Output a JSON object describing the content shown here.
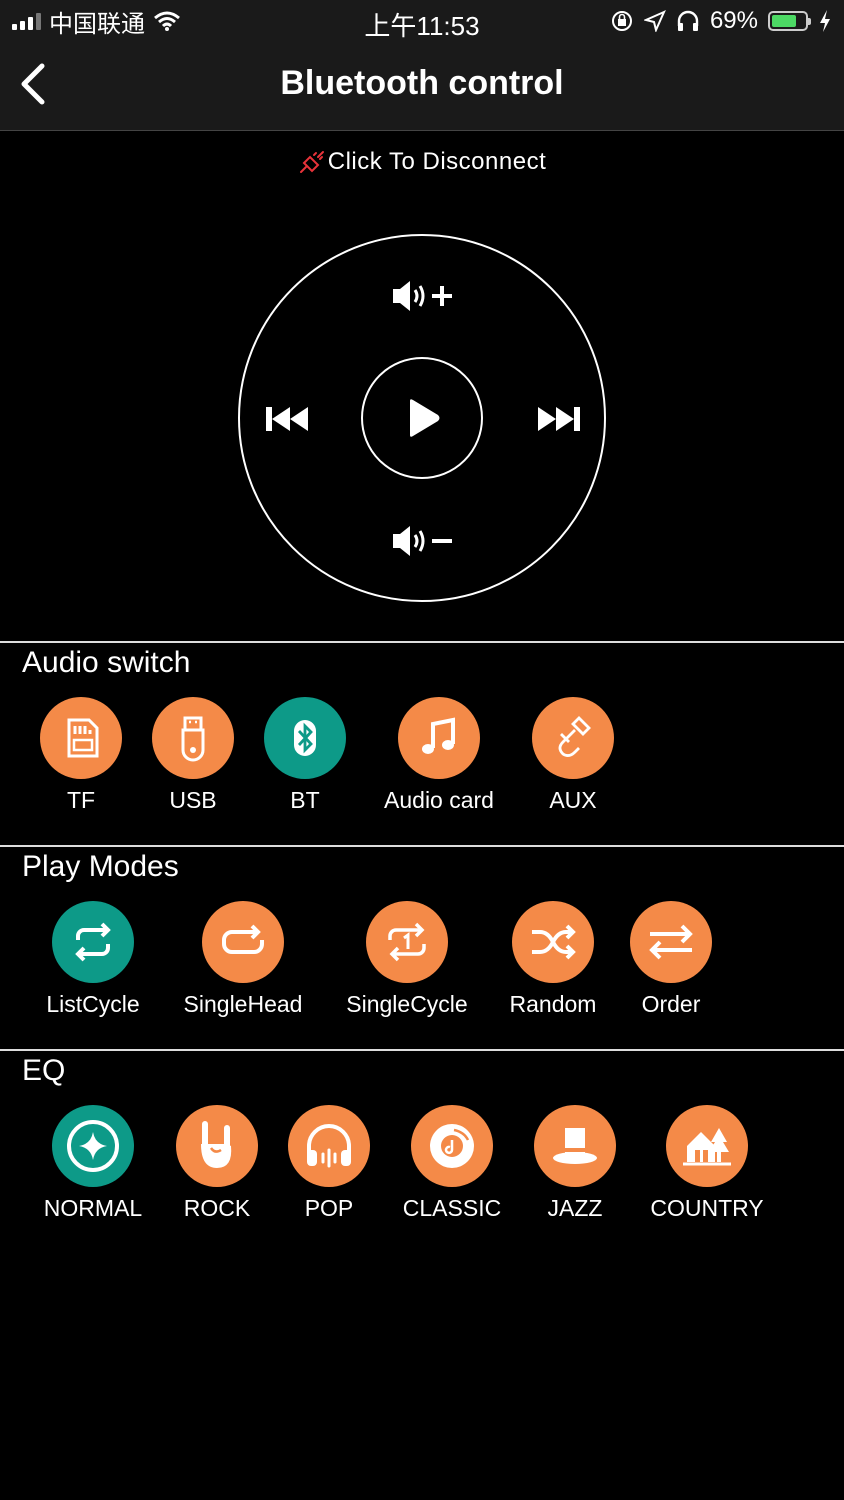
{
  "status_bar": {
    "carrier": "中国联通",
    "time": "上午11:53",
    "battery_percent": "69%",
    "battery_level": 0.69,
    "icons": [
      "signal-icon",
      "wifi-icon",
      "orientation-lock-icon",
      "location-icon",
      "headphones-icon",
      "battery-icon",
      "charging-icon"
    ]
  },
  "nav": {
    "title": "Bluetooth control",
    "back_icon": "chevron-left-icon"
  },
  "connection": {
    "label": "Click To Disconnect",
    "icon": "plug-icon",
    "icon_color": "#e8333a"
  },
  "controls": {
    "buttons": [
      "volume-up",
      "previous",
      "play",
      "next",
      "volume-down"
    ]
  },
  "audio_switch": {
    "title": "Audio switch",
    "items": [
      {
        "label": "TF",
        "icon": "sd-card-icon",
        "active": false
      },
      {
        "label": "USB",
        "icon": "usb-drive-icon",
        "active": false
      },
      {
        "label": "BT",
        "icon": "bluetooth-icon",
        "active": true
      },
      {
        "label": "Audio card",
        "icon": "music-note-icon",
        "active": false
      },
      {
        "label": "AUX",
        "icon": "aux-cable-icon",
        "active": false
      }
    ]
  },
  "play_modes": {
    "title": "Play Modes",
    "items": [
      {
        "label": "ListCycle",
        "icon": "repeat-all-icon",
        "active": true
      },
      {
        "label": "SingleHead",
        "icon": "repeat-once-loop-icon",
        "active": false
      },
      {
        "label": "SingleCycle",
        "icon": "repeat-one-icon",
        "active": false
      },
      {
        "label": "Random",
        "icon": "shuffle-icon",
        "active": false
      },
      {
        "label": "Order",
        "icon": "order-arrows-icon",
        "active": false
      }
    ]
  },
  "eq": {
    "title": "EQ",
    "items": [
      {
        "label": "NORMAL",
        "icon": "star-compass-icon",
        "active": true
      },
      {
        "label": "ROCK",
        "icon": "rock-hand-icon",
        "active": false
      },
      {
        "label": "POP",
        "icon": "headphones-icon",
        "active": false
      },
      {
        "label": "CLASSIC",
        "icon": "vinyl-record-icon",
        "active": false
      },
      {
        "label": "JAZZ",
        "icon": "hat-icon",
        "active": false
      },
      {
        "label": "COUNTRY",
        "icon": "house-tree-icon",
        "active": false
      }
    ]
  },
  "colors": {
    "accent_inactive": "#f48a48",
    "accent_active": "#0d9a88",
    "background": "#000000"
  }
}
